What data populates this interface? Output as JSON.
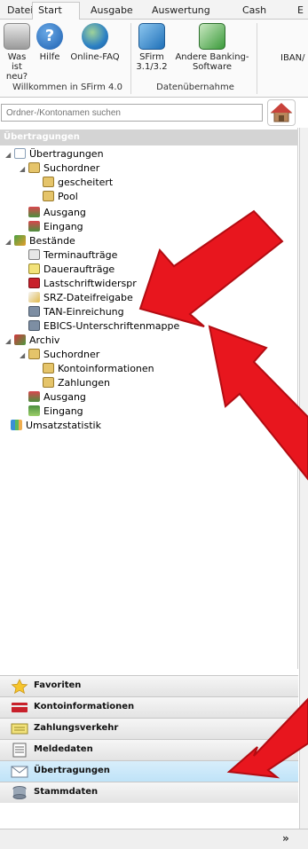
{
  "menu": {
    "tabs": [
      "Datei",
      "Start",
      "Ausgabe",
      "Auswertung",
      "Cash",
      "E"
    ]
  },
  "ribbon": {
    "buttons": [
      {
        "label": "Was ist neu?",
        "icon": "whats-new-icon"
      },
      {
        "label": "Hilfe",
        "icon": "help-icon"
      },
      {
        "label": "Online-FAQ",
        "icon": "globe-icon"
      },
      {
        "label": "SFirm 3.1/3.2",
        "icon": "import-sfirm-icon"
      },
      {
        "label": "Andere Banking-Software",
        "icon": "import-other-icon"
      },
      {
        "label": "IBAN/",
        "icon": ""
      }
    ],
    "groups": [
      "Willkommen in SFirm 4.0",
      "Datenübernahme"
    ]
  },
  "search": {
    "placeholder": "Ordner-/Kontonamen suchen",
    "home_icon": "house-icon"
  },
  "panel": {
    "header": "Übertragungen"
  },
  "tree": [
    {
      "label": "Übertragungen",
      "icon": "envelope-icon"
    },
    {
      "label": "Suchordner",
      "icon": "search-folder-icon"
    },
    {
      "label": "gescheitert",
      "icon": "search-folder-icon"
    },
    {
      "label": "Pool",
      "icon": "search-folder-icon"
    },
    {
      "label": "Ausgang",
      "icon": "outbox-icon"
    },
    {
      "label": "Eingang",
      "icon": "inbox-icon"
    },
    {
      "label": "Bestände",
      "icon": "inventory-icon"
    },
    {
      "label": "Terminaufträge",
      "icon": "calendar-icon"
    },
    {
      "label": "Daueraufträge",
      "icon": "standing-order-icon"
    },
    {
      "label": "Lastschriftwiderspr",
      "icon": "debit-objection-icon"
    },
    {
      "label": "SRZ-Dateifreigabe",
      "icon": "file-release-icon"
    },
    {
      "label": "TAN-Einreichung",
      "icon": "tan-icon"
    },
    {
      "label": "EBICS-Unterschriftenmappe",
      "icon": "signature-folder-icon"
    },
    {
      "label": "Archiv",
      "icon": "archive-icon"
    },
    {
      "label": "Suchordner",
      "icon": "search-folder-icon"
    },
    {
      "label": "Kontoinformationen",
      "icon": "search-folder-icon"
    },
    {
      "label": "Zahlungen",
      "icon": "search-folder-icon"
    },
    {
      "label": "Ausgang",
      "icon": "outbox-icon"
    },
    {
      "label": "Eingang",
      "icon": "inbox-icon"
    },
    {
      "label": "Umsatzstatistik",
      "icon": "statistics-icon"
    }
  ],
  "nav": [
    {
      "label": "Favoriten",
      "icon": "star-icon"
    },
    {
      "label": "Kontoinformationen",
      "icon": "account-info-icon"
    },
    {
      "label": "Zahlungsverkehr",
      "icon": "payments-icon"
    },
    {
      "label": "Meldedaten",
      "icon": "report-data-icon"
    },
    {
      "label": "Übertragungen",
      "icon": "envelope-icon"
    },
    {
      "label": "Stammdaten",
      "icon": "master-data-icon"
    }
  ],
  "bottom": {
    "chevron": "»"
  },
  "colors": {
    "arrow": "#e8161e",
    "active_nav": "#c7e7f9",
    "header_bg": "#d4d4d4"
  }
}
